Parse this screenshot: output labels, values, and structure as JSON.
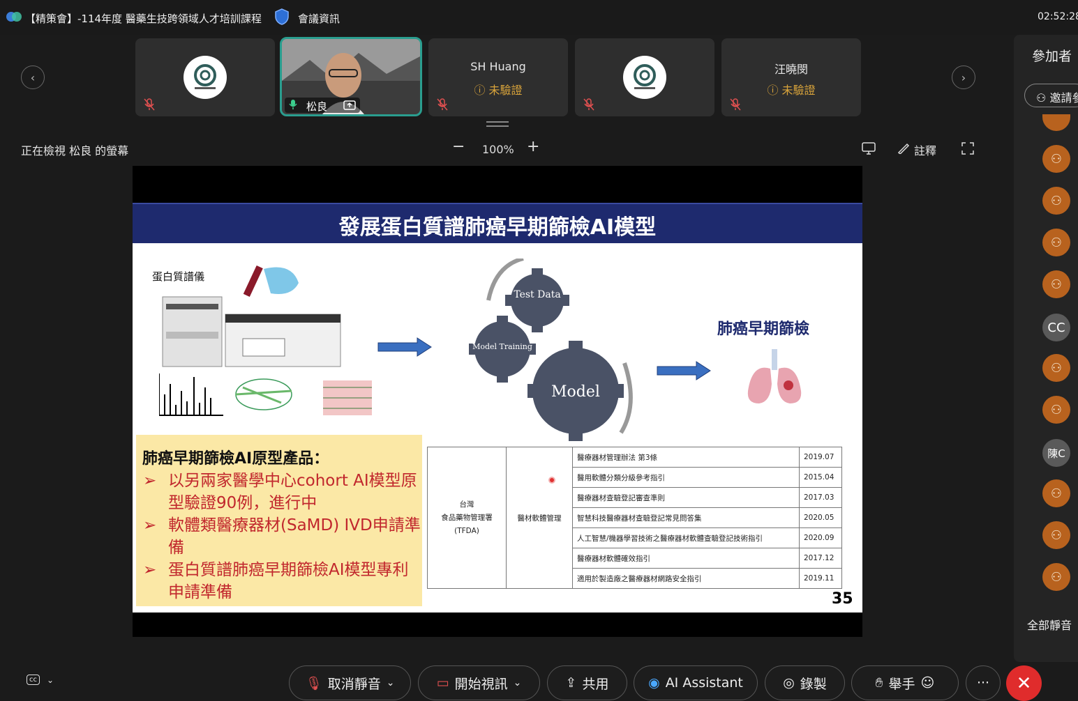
{
  "window": {
    "title": "【精策會】-114年度 醫藥生技跨領域人才培訓課程",
    "meeting_info": "會議資訊",
    "clock": "02:52:28"
  },
  "participants_strip": [
    {
      "name": "",
      "status": ""
    },
    {
      "name": "松良",
      "status": ""
    },
    {
      "name": "SH Huang",
      "status": "未驗證"
    },
    {
      "name": "",
      "status": ""
    },
    {
      "name": "汪曉閔",
      "status": "未驗證"
    }
  ],
  "view_bar": {
    "viewing": "正在檢視 松良 的螢幕",
    "zoom_minus": "−",
    "zoom_level": "100%",
    "zoom_plus": "+",
    "annotate": "註釋"
  },
  "slide": {
    "title": "發展蛋白質譜肺癌早期篩檢AI模型",
    "instrument_label": "蛋白質譜儀",
    "gear_labels": [
      "Test Data",
      "Model Training",
      "Model"
    ],
    "result_label": "肺癌早期篩檢",
    "product_heading": "肺癌早期篩檢AI原型產品：",
    "product_bullets": [
      "以另兩家醫學中心cohort AI模型原型驗證90例，進行中",
      "軟體類醫療器材(SaMD) IVD申請準備",
      "蛋白質譜肺癌早期篩檢AI模型專利申請準備"
    ],
    "bullet_marker": "➢",
    "table": {
      "agency": [
        "台灣",
        "食品藥物管理署",
        "(TFDA)"
      ],
      "category": "醫材軟體管理",
      "rows": [
        {
          "item": "醫療器材管理辦法  第3條",
          "date": "2019.07"
        },
        {
          "item": "醫用軟體分類分級參考指引",
          "date": "2015.04"
        },
        {
          "item": "醫療器材查驗登記審查準則",
          "date": "2017.03"
        },
        {
          "item": "智慧科技醫療器材查驗登記常見問答集",
          "date": "2020.05"
        },
        {
          "item": "人工智慧/機器學習技術之醫療器材軟體查驗登記技術指引",
          "date": "2020.09"
        },
        {
          "item": "醫療器材軟體確效指引",
          "date": "2017.12"
        },
        {
          "item": "適用於製造廠之醫療器材網路安全指引",
          "date": "2019.11"
        }
      ]
    },
    "page_number": "35"
  },
  "side_panel": {
    "title": "參加者",
    "invite": "邀請參",
    "avatars": [
      "person",
      "person",
      "person",
      "person",
      "person",
      "CC",
      "person",
      "person",
      "陳C",
      "person",
      "person",
      "person"
    ],
    "mute_all": "全部靜音"
  },
  "controls": {
    "mute": "取消靜音",
    "video": "開始視訊",
    "share": "共用",
    "ai": "AI Assistant",
    "record": "錄製",
    "raise_hand": "舉手",
    "more": "···",
    "leave": "✕"
  }
}
